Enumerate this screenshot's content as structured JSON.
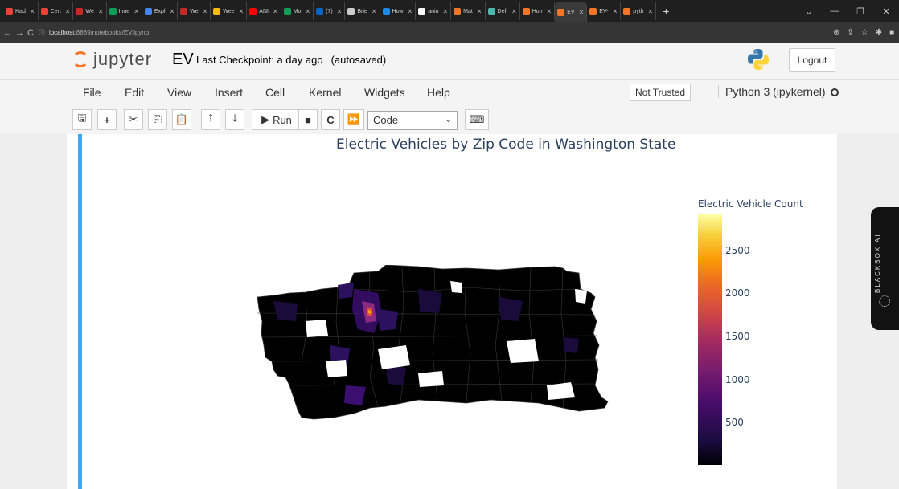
{
  "browser": {
    "tabs": [
      {
        "label": "Had",
        "color": "#ea4335"
      },
      {
        "label": "Cert",
        "color": "#ea4335"
      },
      {
        "label": "We",
        "color": "#c62828"
      },
      {
        "label": "Inne",
        "color": "#0f9d58"
      },
      {
        "label": "Expl",
        "color": "#4285f4"
      },
      {
        "label": "We",
        "color": "#c62828"
      },
      {
        "label": "Wee",
        "color": "#fbbc04"
      },
      {
        "label": "ANI",
        "color": "#ff0000"
      },
      {
        "label": "Mo",
        "color": "#0f9d58"
      },
      {
        "label": "(7)",
        "color": "#0a66c2"
      },
      {
        "label": "Brie",
        "color": "#cccccc"
      },
      {
        "label": "How",
        "color": "#1e88e5"
      },
      {
        "label": "anin",
        "color": "#ffffff"
      },
      {
        "label": "Mat",
        "color": "#f37726"
      },
      {
        "label": "Defi",
        "color": "#4db6ac"
      },
      {
        "label": "Hon",
        "color": "#f37726"
      },
      {
        "label": "EV",
        "color": "#f37726",
        "active": true
      },
      {
        "label": "EV-",
        "color": "#f37726"
      },
      {
        "label": "pyth",
        "color": "#f37726"
      }
    ],
    "url_host": "localhost",
    "url_path": ":8889/notebooks/EV.ipynb"
  },
  "jupyter": {
    "brand": "jupyter",
    "notebook_name": "EV",
    "checkpoint": "Last Checkpoint: a day ago",
    "autosave": "(autosaved)",
    "logout": "Logout",
    "menu": [
      "File",
      "Edit",
      "View",
      "Insert",
      "Cell",
      "Kernel",
      "Widgets",
      "Help"
    ],
    "trusted": "Not Trusted",
    "kernel_name": "Python 3 (ipykernel)",
    "run_label": "Run",
    "cell_type": "Code"
  },
  "plot": {
    "title": "Electric Vehicles by Zip Code in Washington State",
    "colorbar_title": "Electric Vehicle Count",
    "colorbar_ticks": [
      "2500",
      "2000",
      "1500",
      "1000",
      "500"
    ]
  },
  "chart_data": {
    "type": "heatmap",
    "title": "Electric Vehicles by Zip Code in Washington State",
    "colorbar_title": "Electric Vehicle Count",
    "colorscale": "inferno",
    "range": [
      0,
      2900
    ],
    "colorbar_tickvals": [
      500,
      1000,
      1500,
      2000,
      2500
    ]
  },
  "blackbox": {
    "label": "BLACKBOX AI"
  }
}
